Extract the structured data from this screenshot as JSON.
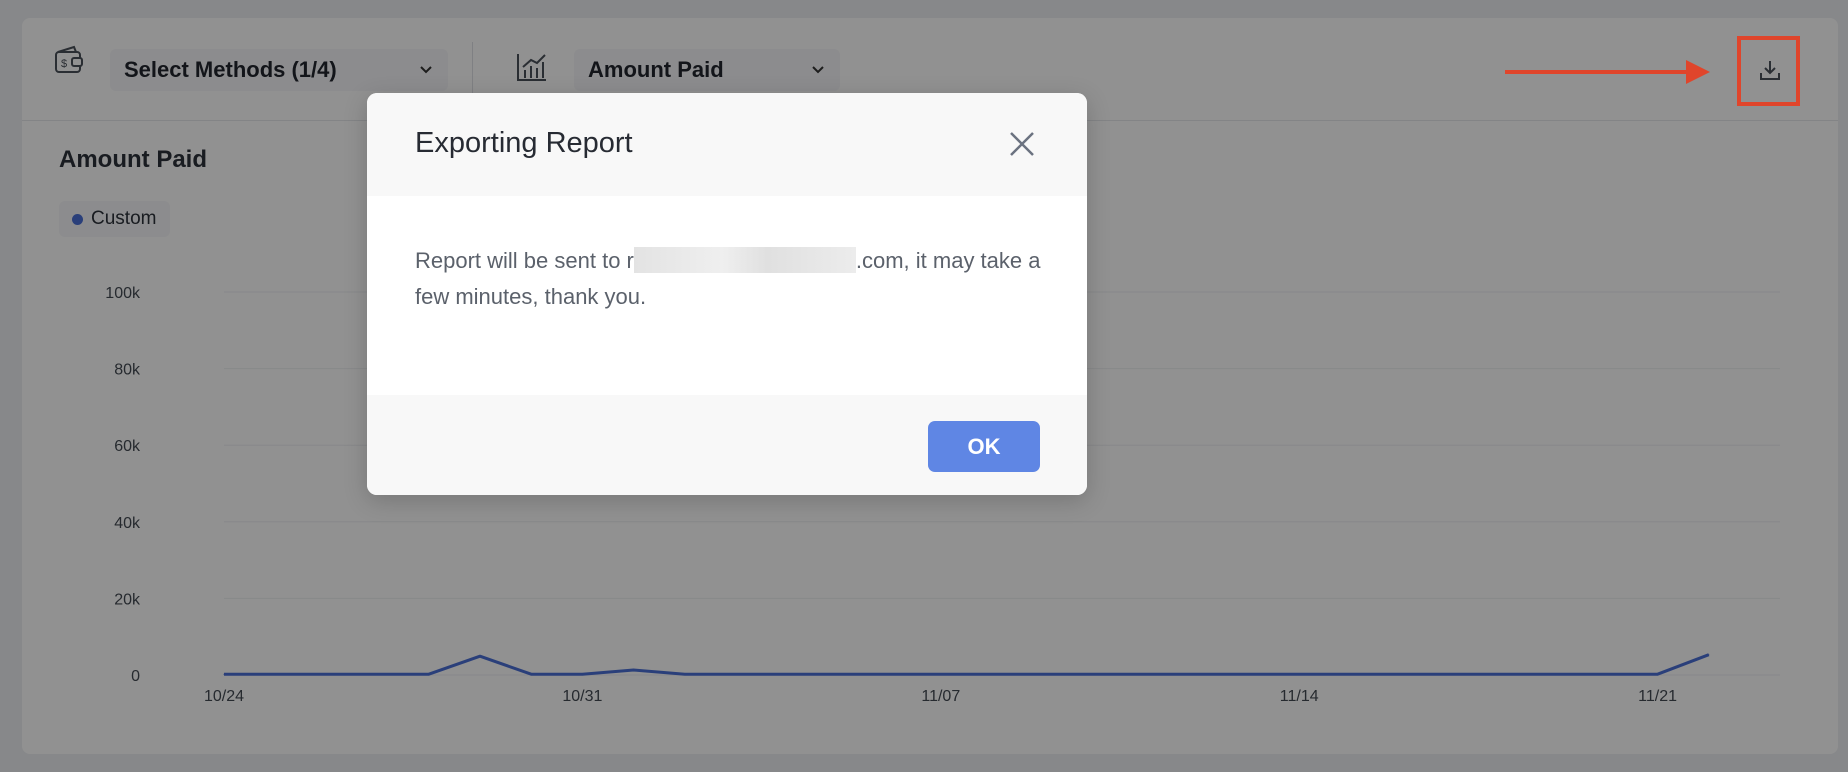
{
  "toolbar": {
    "methods_select_label": "Select Methods (1/4)",
    "metric_select_label": "Amount Paid",
    "wallet_icon": "wallet-dollar-icon",
    "chart_icon": "bar-chart-icon",
    "download_icon": "download-icon"
  },
  "chart_panel": {
    "title": "Amount Paid",
    "legend": [
      {
        "label": "Custom",
        "color": "#4a6fd6"
      }
    ]
  },
  "chart_data": {
    "type": "line",
    "title": "Amount Paid",
    "xlabel": "",
    "ylabel": "",
    "ylim": [
      0,
      100000
    ],
    "y_ticks": [
      "0",
      "20k",
      "40k",
      "60k",
      "80k",
      "100k"
    ],
    "y_tick_values": [
      0,
      20000,
      40000,
      60000,
      80000,
      100000
    ],
    "x_ticks": [
      "10/24",
      "10/31",
      "11/07",
      "11/14",
      "11/21"
    ],
    "x_tick_index": [
      0,
      7,
      14,
      21,
      28
    ],
    "grid": true,
    "series": [
      {
        "name": "Custom",
        "color": "#4a6fd6",
        "x": [
          "10/24",
          "10/25",
          "10/26",
          "10/27",
          "10/28",
          "10/29",
          "10/30",
          "10/31",
          "11/01",
          "11/02",
          "11/03",
          "11/04",
          "11/05",
          "11/06",
          "11/07",
          "11/08",
          "11/09",
          "11/10",
          "11/11",
          "11/12",
          "11/13",
          "11/14",
          "11/15",
          "11/16",
          "11/17",
          "11/18",
          "11/19",
          "11/20",
          "11/21",
          "11/22"
        ],
        "values": [
          200,
          200,
          200,
          200,
          200,
          4900,
          200,
          200,
          1300,
          200,
          200,
          200,
          200,
          200,
          200,
          200,
          200,
          200,
          200,
          200,
          200,
          200,
          200,
          200,
          200,
          200,
          200,
          200,
          200,
          5300
        ]
      }
    ]
  },
  "modal": {
    "title": "Exporting Report",
    "body_prefix": "Report will be sent to r",
    "body_suffix": ".com, it may take a few minutes, thank you.",
    "ok_label": "OK",
    "close_icon": "close-icon"
  },
  "annotation": {
    "arrow_color": "#e0452b"
  }
}
